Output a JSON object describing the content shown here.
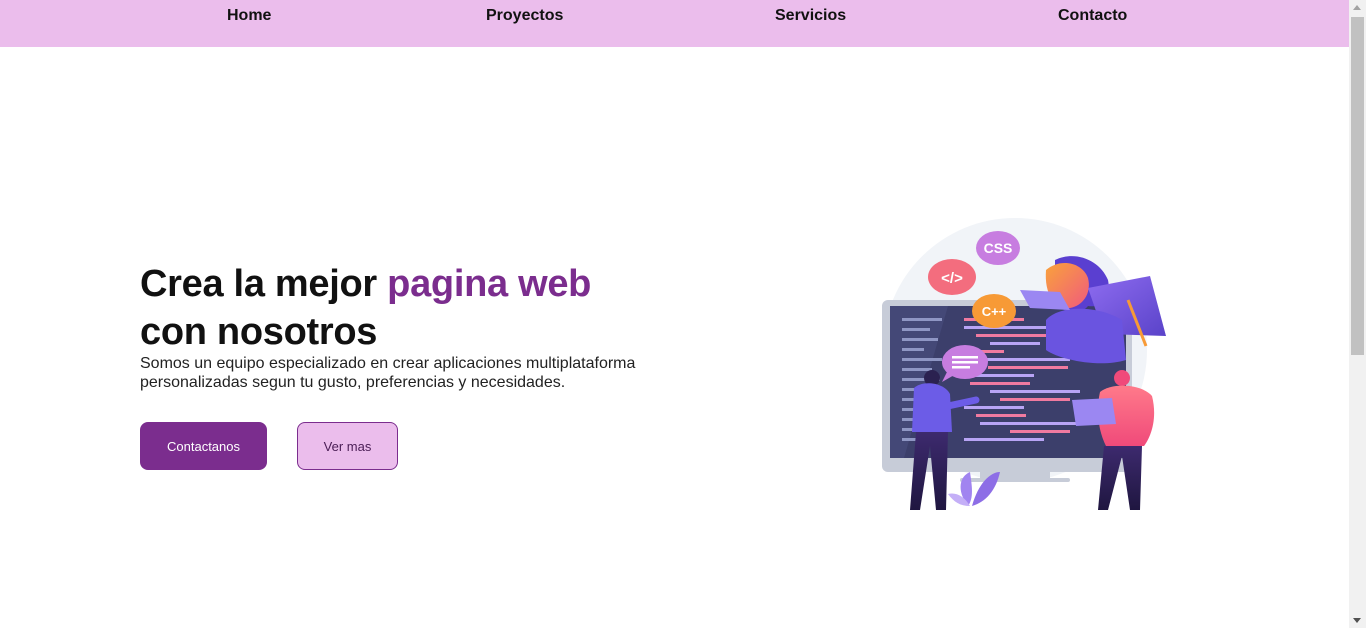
{
  "nav": {
    "items": [
      {
        "label": "Home"
      },
      {
        "label": "Proyectos"
      },
      {
        "label": "Servicios"
      },
      {
        "label": "Contacto"
      }
    ]
  },
  "hero": {
    "title_part1": "Crea la mejor ",
    "title_accent": "pagina web",
    "title_part2": "con nosotros",
    "subtitle": "Somos un equipo especializado en crear aplicaciones multiplataforma personalizadas segun tu gusto, preferencias y necesidades.",
    "primary_button": "Contactanos",
    "secondary_button": "Ver mas"
  },
  "illustration": {
    "bubbles": [
      "CSS",
      "</>",
      "C++"
    ]
  },
  "colors": {
    "nav_bg": "#ebbdec",
    "accent": "#7b2d8e",
    "secondary_button_bg": "#ebbdec"
  }
}
